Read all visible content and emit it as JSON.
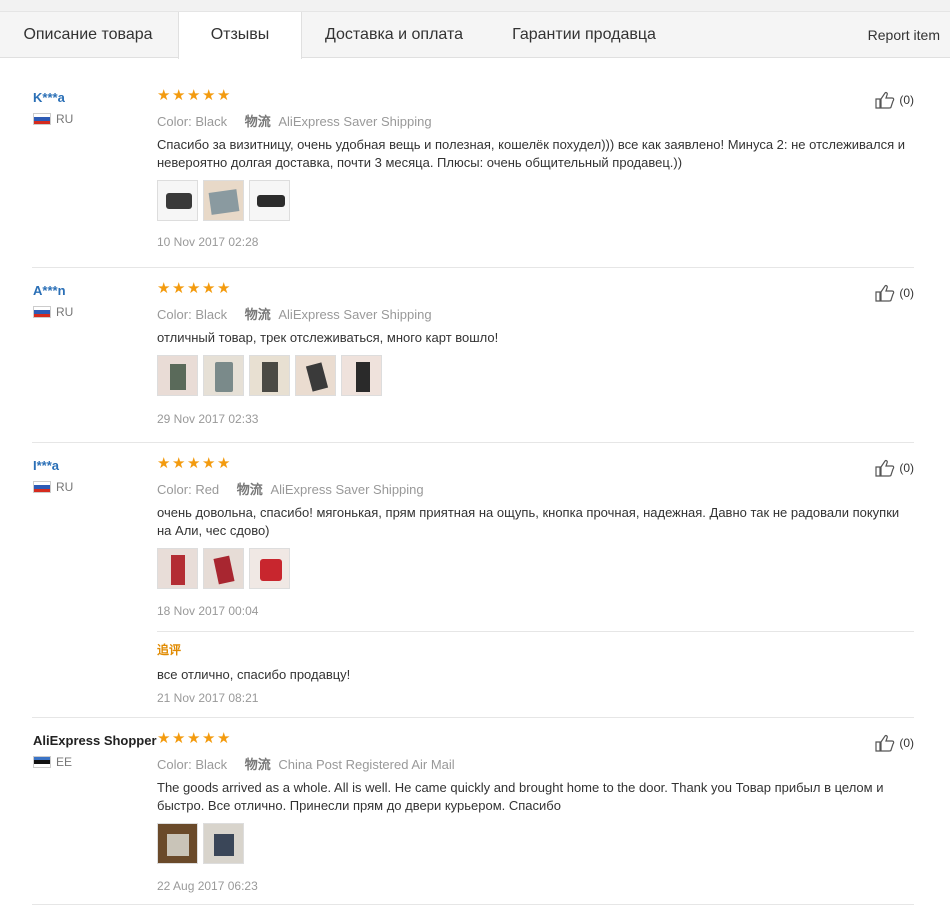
{
  "tabs": {
    "items": [
      {
        "label": "Описание товара"
      },
      {
        "label": "Отзывы"
      },
      {
        "label": "Доставка и оплата"
      },
      {
        "label": "Гарантии продавца"
      }
    ],
    "report": "Report item"
  },
  "reviews": [
    {
      "buyer": "K***a",
      "country": "RU",
      "rating": 5,
      "color_label": "Color:",
      "color": "Black",
      "shipping_label": "物流",
      "shipping": "AliExpress Saver Shipping",
      "text": "Спасибо за визитницу, очень удобная вещь и полезная, кошелёк похудел))) все как заявлено! Минуса 2: не отслеживался и невероятно долгая доставка, почти 3 месяца. Плюсы: очень общительный продавец.))",
      "photos": 3,
      "date": "10 Nov 2017 02:28",
      "likes": "(0)"
    },
    {
      "buyer": "A***n",
      "country": "RU",
      "rating": 5,
      "color_label": "Color:",
      "color": "Black",
      "shipping_label": "物流",
      "shipping": "AliExpress Saver Shipping",
      "text": "отличный товар, трек отслеживаться, много карт вошло!",
      "photos": 5,
      "date": "29 Nov 2017 02:33",
      "likes": "(0)"
    },
    {
      "buyer": "I***a",
      "country": "RU",
      "rating": 5,
      "color_label": "Color:",
      "color": "Red",
      "shipping_label": "物流",
      "shipping": "AliExpress Saver Shipping",
      "text": "очень довольна, спасибо! мягонькая, прям приятная на ощупь, кнопка прочная, надежная. Давно так не радовали покупки на Али, чес сдово)",
      "photos": 3,
      "date": "18 Nov 2017 00:04",
      "followup_label": "追评",
      "followup_text": "все отлично, спасибо продавцу!",
      "followup_date": "21 Nov 2017 08:21",
      "likes": "(0)"
    },
    {
      "buyer": "AliExpress Shopper",
      "country": "EE",
      "rating": 5,
      "color_label": "Color:",
      "color": "Black",
      "shipping_label": "物流",
      "shipping": "China Post Registered Air Mail",
      "text": "The goods arrived as a whole. All is well. He came quickly and brought home to the door. Thank you Товар прибыл в целом и быстро. Все отлично. Принесли прям до двери курьером. Спасибо",
      "photos": 2,
      "date": "22 Aug 2017 06:23",
      "likes": "(0)"
    }
  ],
  "icons": {
    "star": "star-icon",
    "like": "thumbs-up-icon",
    "flag_ru": "flag-ru-icon",
    "flag_ee": "flag-ee-icon"
  },
  "colors": {
    "star": "#f39b0f",
    "buyer_link": "#2a6fb6",
    "followup": "#e08a00"
  }
}
